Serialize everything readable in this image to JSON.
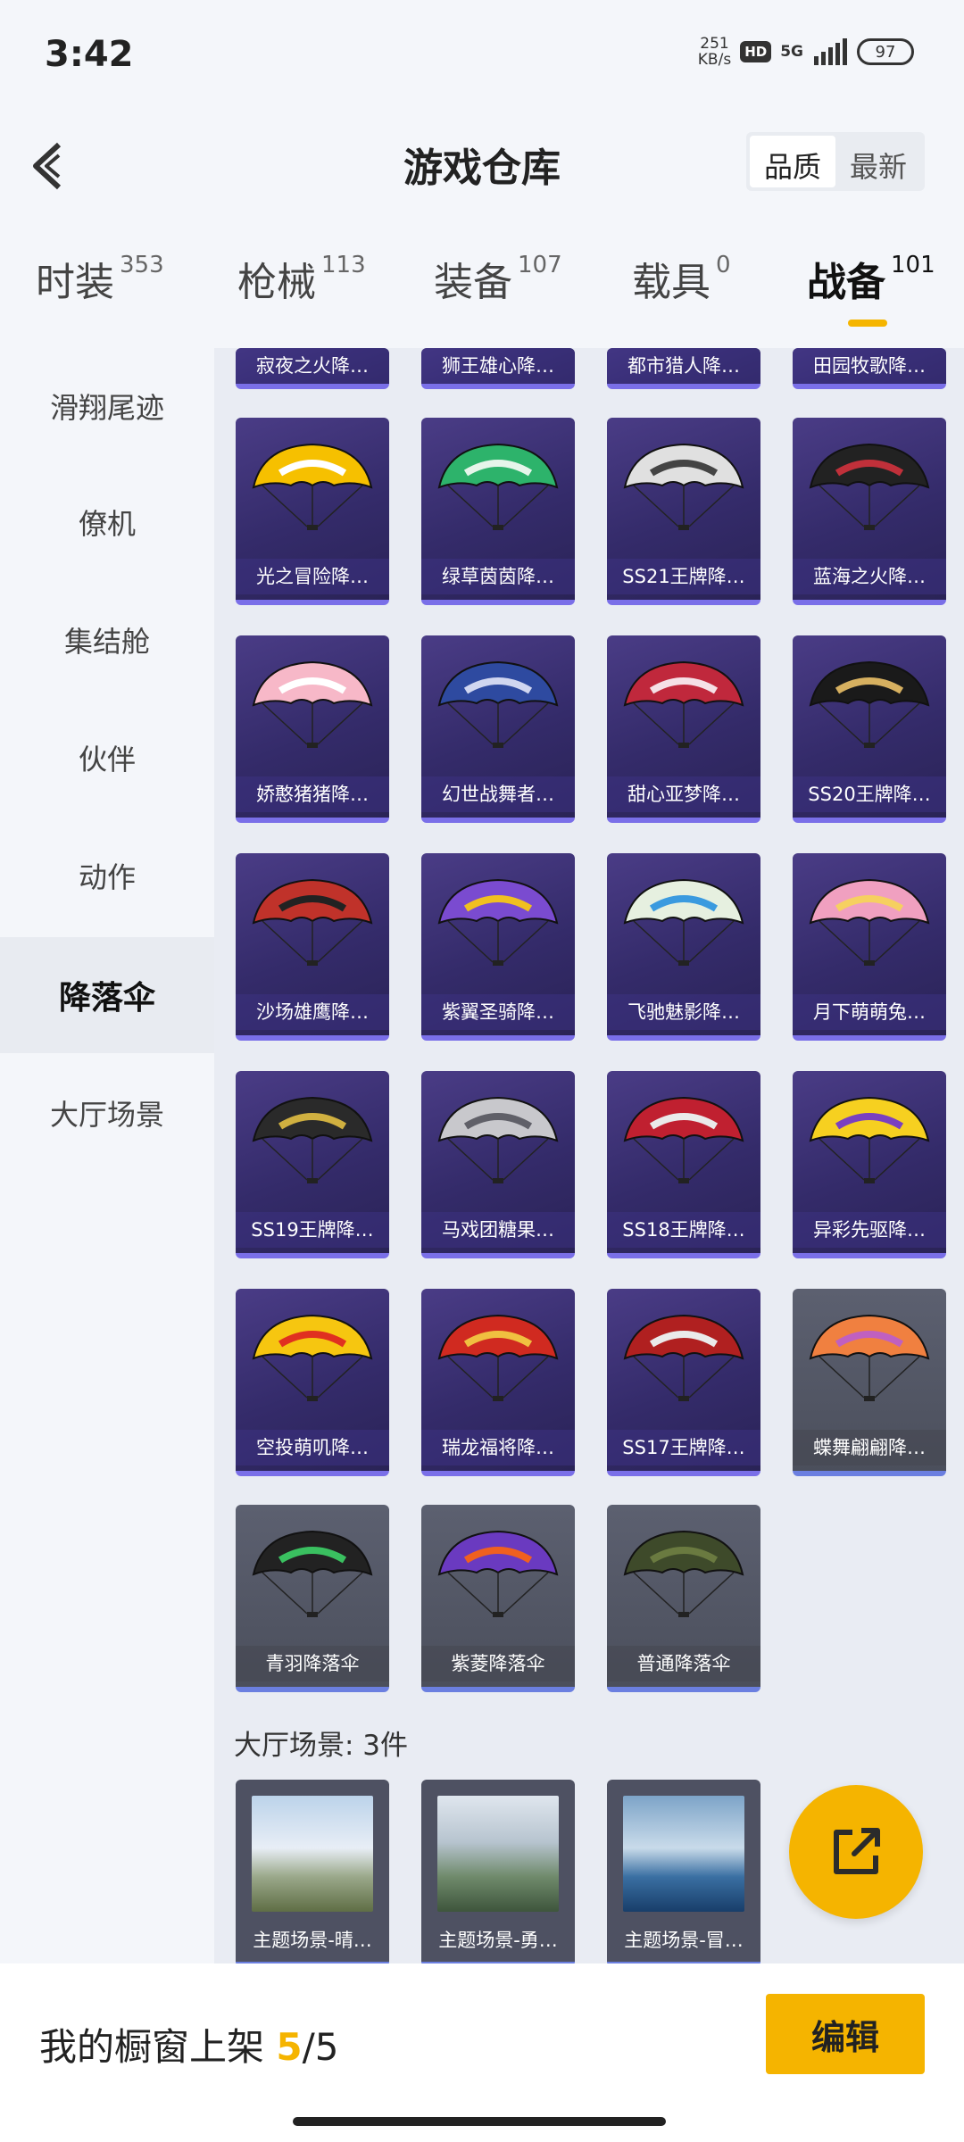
{
  "status_bar": {
    "time": "3:42",
    "speed_value": "251",
    "speed_unit": "KB/s",
    "hd": "HD",
    "network": "5G",
    "battery": "97"
  },
  "header": {
    "title": "游戏仓库",
    "sort_quality": "品质",
    "sort_latest": "最新"
  },
  "tabs": [
    {
      "label": "时装",
      "count": "353"
    },
    {
      "label": "枪械",
      "count": "113"
    },
    {
      "label": "装备",
      "count": "107"
    },
    {
      "label": "载具",
      "count": "0"
    },
    {
      "label": "战备",
      "count": "101"
    }
  ],
  "sidenav": [
    {
      "label": "滑翔尾迹"
    },
    {
      "label": "僚机"
    },
    {
      "label": "集结舱"
    },
    {
      "label": "伙伴"
    },
    {
      "label": "动作"
    },
    {
      "label": "降落伞"
    },
    {
      "label": "大厅场景"
    }
  ],
  "items": [
    {
      "name": "寂夜之火降…"
    },
    {
      "name": "狮王雄心降…"
    },
    {
      "name": "都市猎人降…"
    },
    {
      "name": "田园牧歌降…"
    },
    {
      "name": "光之冒险降…"
    },
    {
      "name": "绿草茵茵降…"
    },
    {
      "name": "SS21王牌降…"
    },
    {
      "name": "蓝海之火降…"
    },
    {
      "name": "娇憨猪猪降…"
    },
    {
      "name": "幻世战舞者…"
    },
    {
      "name": "甜心亚梦降…"
    },
    {
      "name": "SS20王牌降…"
    },
    {
      "name": "沙场雄鹰降…"
    },
    {
      "name": "紫翼圣骑降…"
    },
    {
      "name": "飞驰魅影降…"
    },
    {
      "name": "月下萌萌兔…"
    },
    {
      "name": "SS19王牌降…"
    },
    {
      "name": "马戏团糖果…"
    },
    {
      "name": "SS18王牌降…"
    },
    {
      "name": "异彩先驱降…"
    },
    {
      "name": "空投萌叽降…"
    },
    {
      "name": "瑞龙福将降…"
    },
    {
      "name": "SS17王牌降…"
    },
    {
      "name": "蝶舞翩翩降…"
    },
    {
      "name": "青羽降落伞"
    },
    {
      "name": "紫菱降落伞"
    },
    {
      "name": "普通降落伞"
    }
  ],
  "section": {
    "title": "大厅场景: 3件"
  },
  "scenes": [
    {
      "name": "主题场景-晴…"
    },
    {
      "name": "主题场景-勇…"
    },
    {
      "name": "主题场景-冒…"
    }
  ],
  "bottom": {
    "label": "我的橱窗上架 ",
    "count": "5",
    "total": "/5",
    "edit": "编辑"
  },
  "colors": {
    "accent": "#f5b400",
    "card_purple": "#3a3075",
    "card_grey": "#555a68"
  }
}
